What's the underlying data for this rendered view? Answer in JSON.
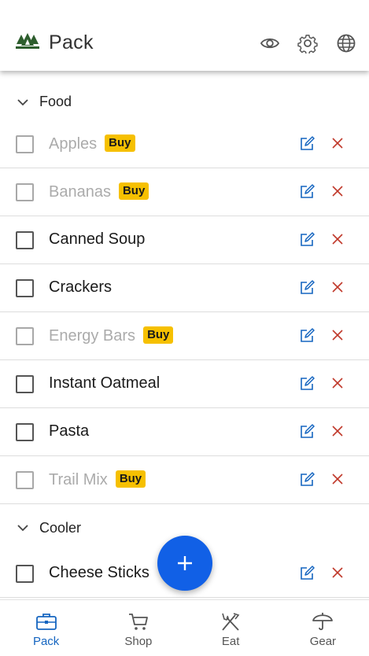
{
  "appbar": {
    "title": "Pack",
    "icons": [
      "forest-logo-icon",
      "eye-icon",
      "gear-icon",
      "globe-icon"
    ]
  },
  "colors": {
    "accent": "#1160e6",
    "active_nav": "#1565c0",
    "buy_badge": "#f6c000",
    "delete": "#c0392b",
    "edit": "#1565c0",
    "logo": "#2e5e2e"
  },
  "sections": [
    {
      "label": "Food",
      "items": [
        {
          "name": "Apples",
          "packed": true,
          "buy": "Buy"
        },
        {
          "name": "Bananas",
          "packed": true,
          "buy": "Buy"
        },
        {
          "name": "Canned Soup",
          "packed": false,
          "buy": ""
        },
        {
          "name": "Crackers",
          "packed": false,
          "buy": ""
        },
        {
          "name": "Energy Bars",
          "packed": true,
          "buy": "Buy"
        },
        {
          "name": "Instant Oatmeal",
          "packed": false,
          "buy": ""
        },
        {
          "name": "Pasta",
          "packed": false,
          "buy": ""
        },
        {
          "name": "Trail Mix",
          "packed": true,
          "buy": "Buy"
        }
      ]
    },
    {
      "label": "Cooler",
      "items": [
        {
          "name": "Cheese Sticks",
          "packed": false,
          "buy": ""
        }
      ]
    }
  ],
  "fab": {
    "icon": "plus-icon"
  },
  "bottom_nav": [
    {
      "label": "Pack",
      "icon": "briefcase-icon",
      "active": true
    },
    {
      "label": "Shop",
      "icon": "cart-icon",
      "active": false
    },
    {
      "label": "Eat",
      "icon": "fork-knife-icon",
      "active": false
    },
    {
      "label": "Gear",
      "icon": "umbrella-icon",
      "active": false
    }
  ]
}
